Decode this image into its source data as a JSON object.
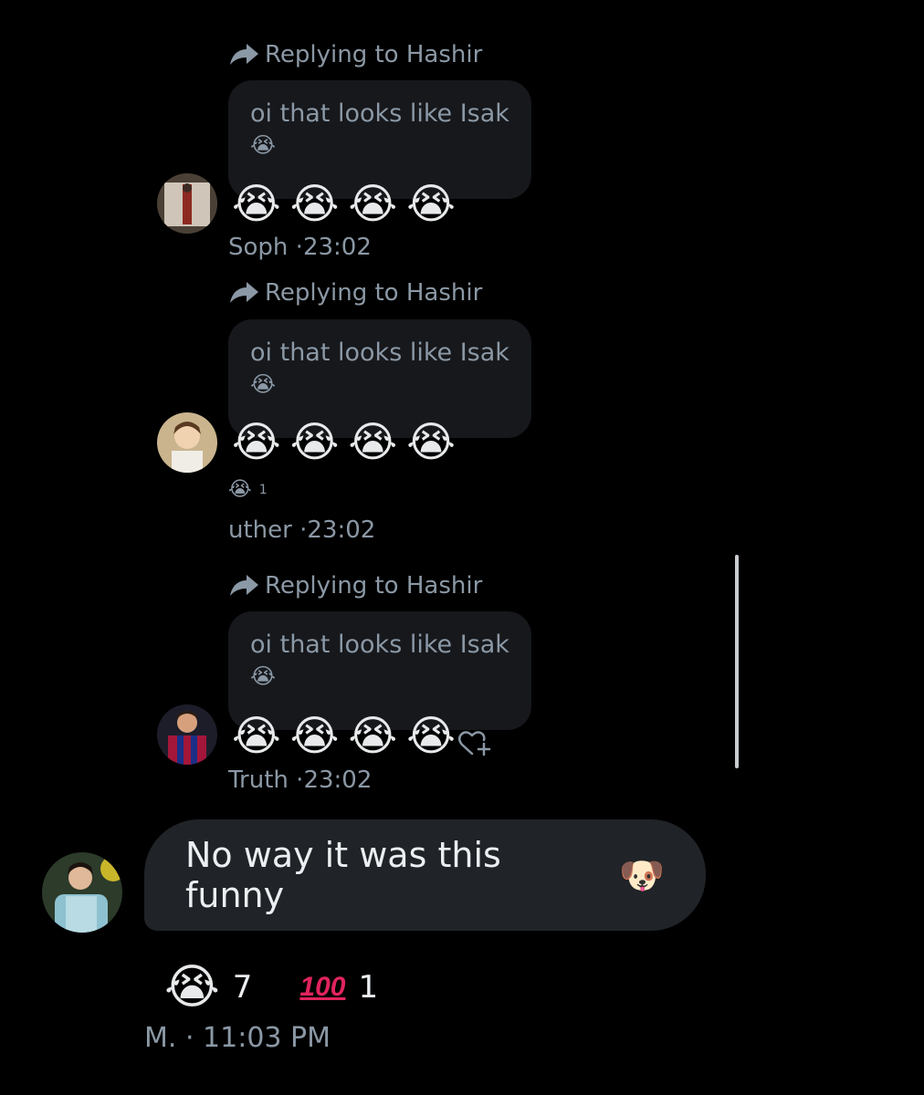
{
  "thread": [
    {
      "replying_to": "Replying to Hashir",
      "quote_text": "oi that looks like Isak",
      "quote_emoji": "😭",
      "emojis": [
        "😭",
        "😭",
        "😭",
        "😭"
      ],
      "author": "Soph",
      "time": "23:02",
      "avatar": "avatar-soph"
    },
    {
      "replying_to": "Replying to Hashir",
      "quote_text": "oi that looks like Isak",
      "quote_emoji": "😭",
      "emojis": [
        "😭",
        "😭",
        "😭",
        "😭"
      ],
      "reaction_emoji": "😭",
      "reaction_count": "1",
      "author": "uther",
      "time": "23:02",
      "avatar": "avatar-uther"
    },
    {
      "replying_to": "Replying to Hashir",
      "quote_text": "oi that looks like Isak",
      "quote_emoji": "😭",
      "emojis": [
        "😭",
        "😭",
        "😭",
        "😭"
      ],
      "author": "Truth",
      "time": "23:02",
      "avatar": "avatar-truth"
    }
  ],
  "main_message": {
    "text": "No way it was this funny",
    "emoji": "🐶",
    "author": "M.",
    "time": "11:03 PM",
    "reactions": [
      {
        "emoji": "😭",
        "count": "7"
      },
      {
        "emoji": "100",
        "count": "1"
      }
    ]
  },
  "colors": {
    "background": "#000000",
    "bubble": "#202327",
    "quote_bubble": "#16181c",
    "muted_text": "#8b98a5"
  }
}
